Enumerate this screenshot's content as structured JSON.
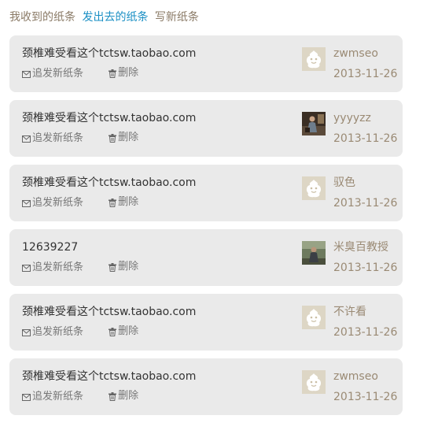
{
  "tabs": {
    "received": "我收到的纸条",
    "sent": "发出去的纸条",
    "write": "写新纸条"
  },
  "notes": [
    {
      "message": "颈椎难受看这个tctsw.taobao.com",
      "reply_label": "追发新纸条",
      "delete_label": "删除",
      "user": "zwmseo",
      "date": "2013-11-26",
      "avatar": "default"
    },
    {
      "message": "颈椎难受看这个tctsw.taobao.com",
      "reply_label": "追发新纸条",
      "delete_label": "删除",
      "user": "yyyyzz",
      "date": "2013-11-26",
      "avatar": "photo-a"
    },
    {
      "message": "颈椎难受看这个tctsw.taobao.com",
      "reply_label": "追发新纸条",
      "delete_label": "删除",
      "user": "驭色",
      "date": "2013-11-26",
      "avatar": "default"
    },
    {
      "message": "12639227",
      "reply_label": "追发新纸条",
      "delete_label": "删除",
      "user": "米臭百教授",
      "date": "2013-11-26",
      "avatar": "photo-b"
    },
    {
      "message": "颈椎难受看这个tctsw.taobao.com",
      "reply_label": "追发新纸条",
      "delete_label": "删除",
      "user": "不许看",
      "date": "2013-11-26",
      "avatar": "default"
    },
    {
      "message": "颈椎难受看这个tctsw.taobao.com",
      "reply_label": "追发新纸条",
      "delete_label": "删除",
      "user": "zwmseo",
      "date": "2013-11-26",
      "avatar": "default"
    }
  ],
  "colors": {
    "active_tab": "#1a8fc4",
    "tab": "#8a7a66",
    "card_bg": "#eaeaea",
    "meta_text": "#9a8a74"
  }
}
